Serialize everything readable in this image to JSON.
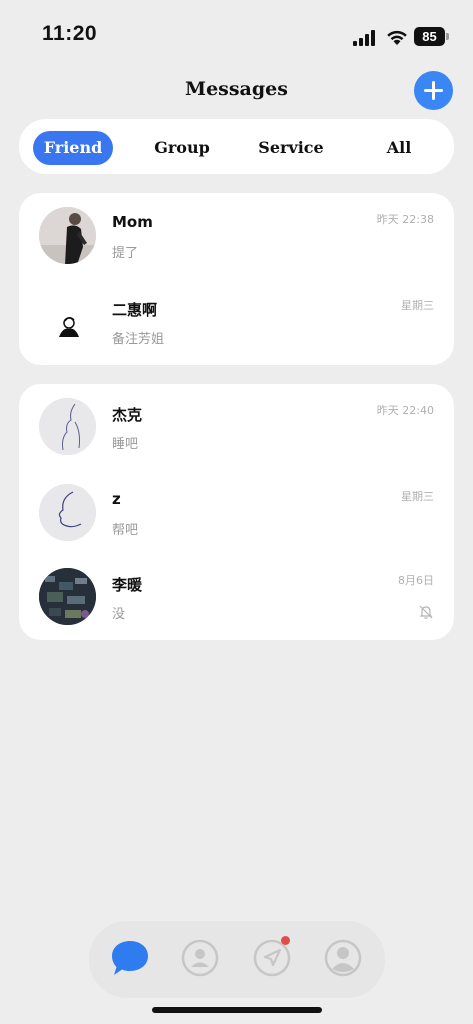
{
  "status_bar": {
    "time": "11:20",
    "battery": "85"
  },
  "header": {
    "title": "Messages",
    "add_icon": "plus-icon",
    "accent_color": "#3a86f5"
  },
  "tabs": [
    {
      "label": "Friend",
      "active": true
    },
    {
      "label": "Group",
      "active": false
    },
    {
      "label": "Service",
      "active": false
    },
    {
      "label": "All",
      "active": false
    }
  ],
  "groups": [
    {
      "conversations": [
        {
          "name": "Mom",
          "preview": "提了",
          "time": "昨天 22:38"
        },
        {
          "name": "二惠啊",
          "preview": "备注芳姐",
          "time": "星期三"
        }
      ]
    },
    {
      "conversations": [
        {
          "name": "杰克",
          "preview": "睡吧",
          "time": "昨天 22:40"
        },
        {
          "name": "z",
          "preview": "帮吧",
          "time": "星期三"
        },
        {
          "name": "李暖",
          "preview": "没",
          "time": "8月6日",
          "muted": true
        }
      ]
    }
  ],
  "bottom_nav": [
    {
      "icon": "chat-bubble-icon",
      "active": true
    },
    {
      "icon": "contacts-icon",
      "active": false
    },
    {
      "icon": "discover-icon",
      "active": false,
      "badge": true
    },
    {
      "icon": "profile-icon",
      "active": false
    }
  ]
}
